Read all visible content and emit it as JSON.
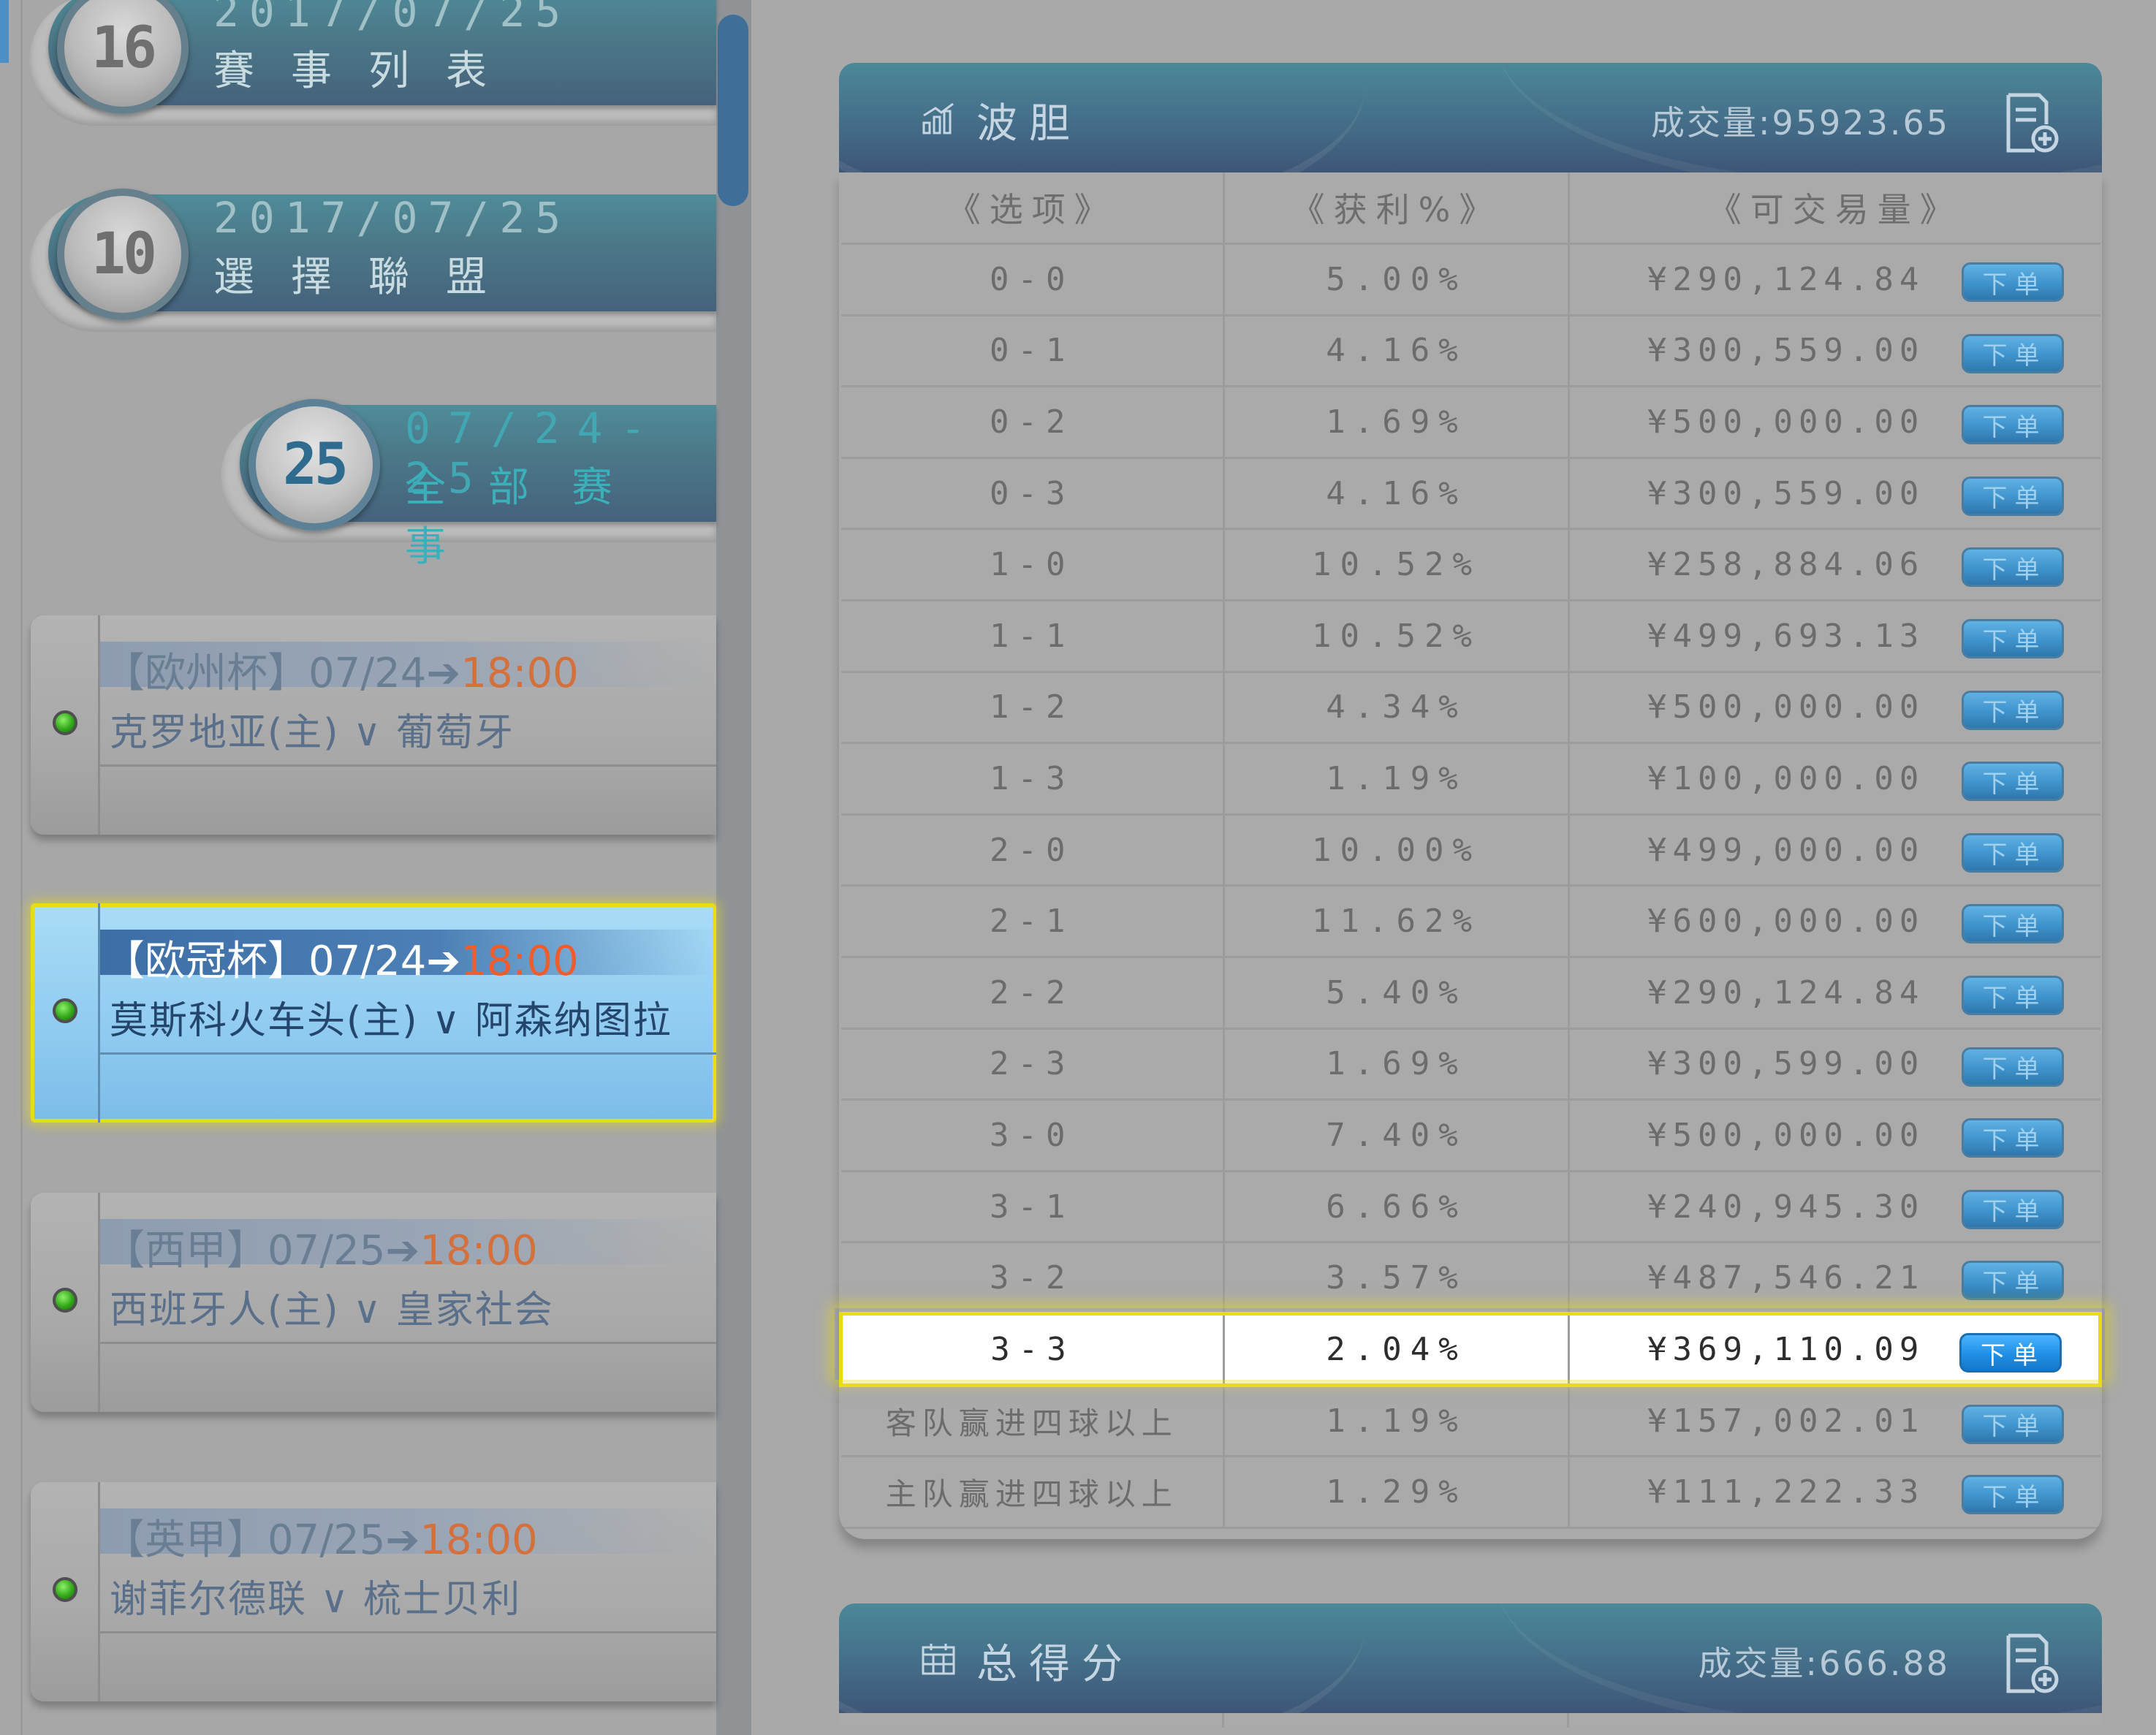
{
  "sidebar": {
    "pills": [
      {
        "number": "16",
        "date": "2017/07/25",
        "title": "賽事列表"
      },
      {
        "number": "10",
        "date": "2017/07/25",
        "title": "選擇聯盟"
      },
      {
        "number": "25",
        "date": "07/24-25",
        "title": "全部赛事"
      }
    ],
    "matches": [
      {
        "league": "【欧州杯】07/24",
        "arrow": "➔",
        "time": "18:00",
        "teams": "克罗地亚(主) ∨ 葡萄牙",
        "selected": false
      },
      {
        "league": "【欧冠杯】07/24",
        "arrow": "➔",
        "time": "18:00",
        "teams": "莫斯科火车头(主) ∨ 阿森纳图拉",
        "selected": true
      },
      {
        "league": "【西甲】07/25",
        "arrow": "➔",
        "time": "18:00",
        "teams": "西班牙人(主) ∨ 皇家社会",
        "selected": false
      },
      {
        "league": "【英甲】07/25",
        "arrow": "➔",
        "time": "18:00",
        "teams": "谢菲尔德联 ∨ 梳士贝利",
        "selected": false
      }
    ]
  },
  "panel1": {
    "title": "波胆",
    "volume_label": "成交量:95923.65",
    "icon": "bar-chart-icon",
    "columns": [
      "《选项》",
      "《获利%》",
      "《可交易量》"
    ],
    "order_label": "下单",
    "rows": [
      {
        "option": "0-0",
        "profit": "5.00%",
        "volume": "¥290,124.84"
      },
      {
        "option": "0-1",
        "profit": "4.16%",
        "volume": "¥300,559.00"
      },
      {
        "option": "0-2",
        "profit": "1.69%",
        "volume": "¥500,000.00"
      },
      {
        "option": "0-3",
        "profit": "4.16%",
        "volume": "¥300,559.00"
      },
      {
        "option": "1-0",
        "profit": "10.52%",
        "volume": "¥258,884.06"
      },
      {
        "option": "1-1",
        "profit": "10.52%",
        "volume": "¥499,693.13"
      },
      {
        "option": "1-2",
        "profit": "4.34%",
        "volume": "¥500,000.00"
      },
      {
        "option": "1-3",
        "profit": "1.19%",
        "volume": "¥100,000.00"
      },
      {
        "option": "2-0",
        "profit": "10.00%",
        "volume": "¥499,000.00"
      },
      {
        "option": "2-1",
        "profit": "11.62%",
        "volume": "¥600,000.00"
      },
      {
        "option": "2-2",
        "profit": "5.40%",
        "volume": "¥290,124.84"
      },
      {
        "option": "2-3",
        "profit": "1.69%",
        "volume": "¥300,599.00"
      },
      {
        "option": "3-0",
        "profit": "7.40%",
        "volume": "¥500,000.00"
      },
      {
        "option": "3-1",
        "profit": "6.66%",
        "volume": "¥240,945.30"
      },
      {
        "option": "3-2",
        "profit": "3.57%",
        "volume": "¥487,546.21"
      },
      {
        "option": "3-3",
        "profit": "2.04%",
        "volume": "¥369,110.09",
        "highlight": true
      },
      {
        "option": "客队赢进四球以上",
        "profit": "1.19%",
        "volume": "¥157,002.01"
      },
      {
        "option": "主队赢进四球以上",
        "profit": "1.29%",
        "volume": "¥111,222.33"
      }
    ]
  },
  "panel2": {
    "title": "总得分",
    "volume_label": "成交量:666.88",
    "icon": "calendar-icon"
  }
}
